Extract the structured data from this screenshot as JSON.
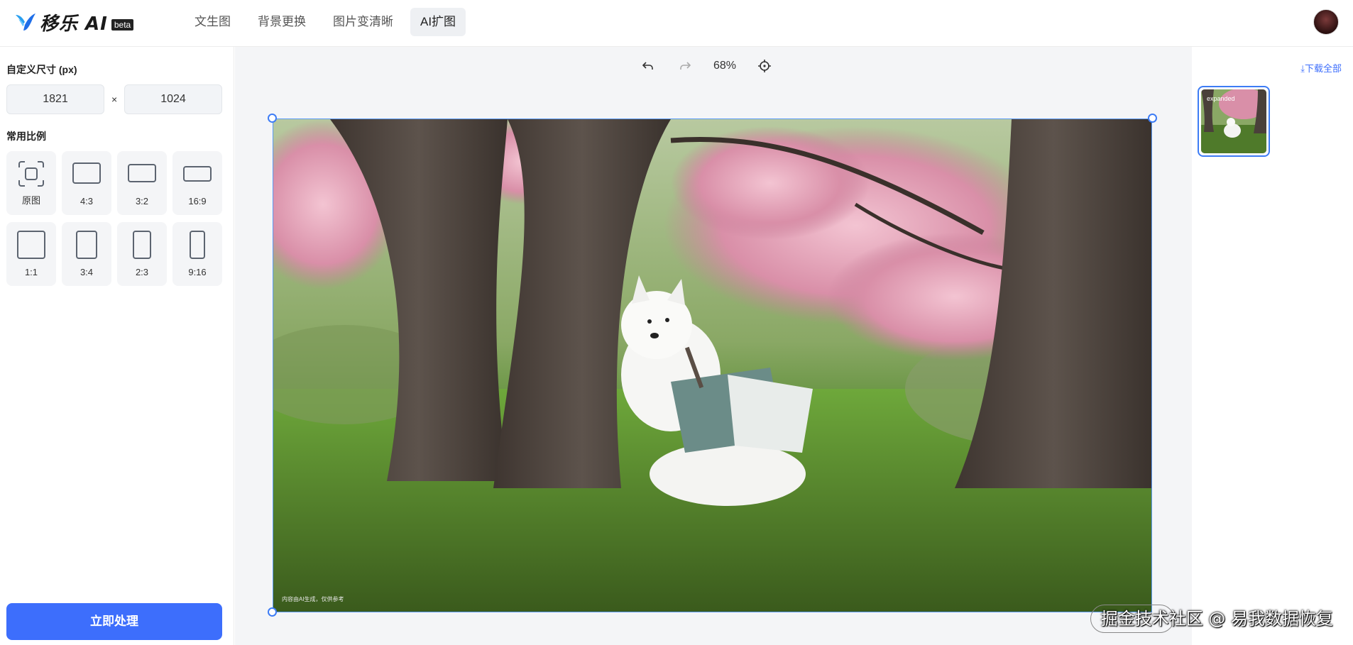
{
  "header": {
    "brand": "移乐 AI",
    "beta": "beta",
    "nav": [
      {
        "label": "文生图"
      },
      {
        "label": "背景更换"
      },
      {
        "label": "图片变清晰"
      },
      {
        "label": "AI扩图"
      }
    ],
    "active_tab": "AI扩图"
  },
  "left_panel": {
    "custom_size_title": "自定义尺寸 (px)",
    "width_value": "1821",
    "height_value": "1024",
    "times": "×",
    "ratio_title": "常用比例",
    "ratios": [
      {
        "label": "原图"
      },
      {
        "label": "4:3"
      },
      {
        "label": "3:2"
      },
      {
        "label": "16:9"
      },
      {
        "label": "1:1"
      },
      {
        "label": "3:4"
      },
      {
        "label": "2:3"
      },
      {
        "label": "9:16"
      }
    ],
    "process_button": "立即处理"
  },
  "canvas": {
    "zoom": "68%",
    "disclaimer": "内容由AI生成，仅供参考",
    "icons": [
      "undo-icon",
      "redo-icon",
      "target-icon"
    ]
  },
  "right_panel": {
    "download_all": "⤓下载全部",
    "thumbnail_label": "expanded"
  },
  "watermark": "掘金技术社区 @ 易我数据恢复",
  "colors": {
    "accent": "#3d6efc",
    "selection": "#3d7cf5",
    "canvas_bg": "#f4f5f7"
  }
}
